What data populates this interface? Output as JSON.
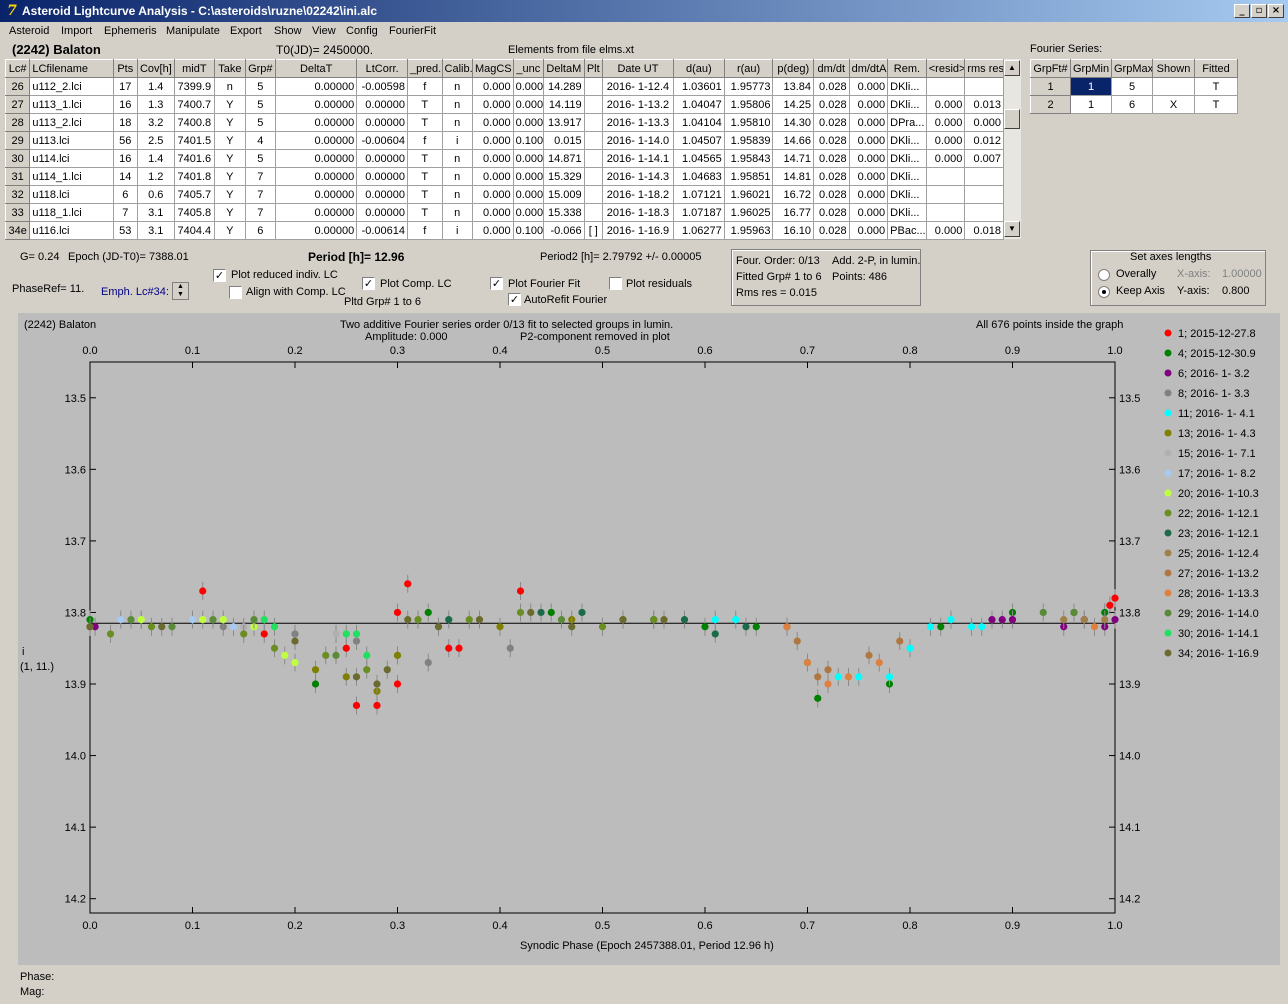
{
  "window": {
    "title": "Asteroid Lightcurve Analysis - C:\\asteroids\\ruzne\\02242\\ini.alc"
  },
  "menu": [
    "Asteroid",
    "Import",
    "Ephemeris",
    "Manipulate",
    "Export",
    "Show",
    "View",
    "Config",
    "FourierFit"
  ],
  "header": {
    "asteroid": "(2242) Balaton",
    "t0": "T0(JD)= 2450000.",
    "elements": "Elements from file elms.xt"
  },
  "table": {
    "columns": [
      "Lc#",
      "LCfilename",
      "Pts",
      "Cov[h]",
      "midT",
      "Take",
      "Grp#",
      "DeltaT",
      "LtCorr.",
      "_pred.",
      "Calib.",
      "MagCS",
      "_unc",
      "DeltaM",
      "Plt",
      "Date UT",
      "d(au)",
      "r(au)",
      "p(deg)",
      "dm/dt",
      "dm/dtA",
      "Rem.",
      "<resid>",
      "rms res"
    ],
    "rows": [
      [
        "26",
        "u112_2.lci",
        "17",
        "1.4",
        "7399.9",
        "n",
        "5",
        "0.00000",
        "-0.00598",
        "f",
        "n",
        "0.000",
        "0.000",
        "14.289",
        "",
        "2016- 1-12.4",
        "1.03601",
        "1.95773",
        "13.84",
        "0.028",
        "0.000",
        "DKli...",
        "",
        ""
      ],
      [
        "27",
        "u113_1.lci",
        "16",
        "1.3",
        "7400.7",
        "Y",
        "5",
        "0.00000",
        "0.00000",
        "T",
        "n",
        "0.000",
        "0.000",
        "14.119",
        "",
        "2016- 1-13.2",
        "1.04047",
        "1.95806",
        "14.25",
        "0.028",
        "0.000",
        "DKli...",
        "0.000",
        "0.013"
      ],
      [
        "28",
        "u113_2.lci",
        "18",
        "3.2",
        "7400.8",
        "Y",
        "5",
        "0.00000",
        "0.00000",
        "T",
        "n",
        "0.000",
        "0.000",
        "13.917",
        "",
        "2016- 1-13.3",
        "1.04104",
        "1.95810",
        "14.30",
        "0.028",
        "0.000",
        "DPra...",
        "0.000",
        "0.000"
      ],
      [
        "29",
        "u113.lci",
        "56",
        "2.5",
        "7401.5",
        "Y",
        "4",
        "0.00000",
        "-0.00604",
        "f",
        "i",
        "0.000",
        "0.100",
        "0.015",
        "",
        "2016- 1-14.0",
        "1.04507",
        "1.95839",
        "14.66",
        "0.028",
        "0.000",
        "DKli...",
        "0.000",
        "0.012"
      ],
      [
        "30",
        "u114.lci",
        "16",
        "1.4",
        "7401.6",
        "Y",
        "5",
        "0.00000",
        "0.00000",
        "T",
        "n",
        "0.000",
        "0.000",
        "14.871",
        "",
        "2016- 1-14.1",
        "1.04565",
        "1.95843",
        "14.71",
        "0.028",
        "0.000",
        "DKli...",
        "0.000",
        "0.007"
      ],
      [
        "31",
        "u114_1.lci",
        "14",
        "1.2",
        "7401.8",
        "Y",
        "7",
        "0.00000",
        "0.00000",
        "T",
        "n",
        "0.000",
        "0.000",
        "15.329",
        "",
        "2016- 1-14.3",
        "1.04683",
        "1.95851",
        "14.81",
        "0.028",
        "0.000",
        "DKli...",
        "",
        ""
      ],
      [
        "32",
        "u118.lci",
        "6",
        "0.6",
        "7405.7",
        "Y",
        "7",
        "0.00000",
        "0.00000",
        "T",
        "n",
        "0.000",
        "0.000",
        "15.009",
        "",
        "2016- 1-18.2",
        "1.07121",
        "1.96021",
        "16.72",
        "0.028",
        "0.000",
        "DKli...",
        "",
        ""
      ],
      [
        "33",
        "u118_1.lci",
        "7",
        "3.1",
        "7405.8",
        "Y",
        "7",
        "0.00000",
        "0.00000",
        "T",
        "n",
        "0.000",
        "0.000",
        "15.338",
        "",
        "2016- 1-18.3",
        "1.07187",
        "1.96025",
        "16.77",
        "0.028",
        "0.000",
        "DKli...",
        "",
        ""
      ],
      [
        "34e",
        "u116.lci",
        "53",
        "3.1",
        "7404.4",
        "Y",
        "6",
        "0.00000",
        "-0.00614",
        "f",
        "i",
        "0.000",
        "0.100",
        "-0.066",
        "[ ]",
        "2016- 1-16.9",
        "1.06277",
        "1.95963",
        "16.10",
        "0.028",
        "0.000",
        "PBac...",
        "0.000",
        "0.018"
      ]
    ]
  },
  "fourier_series": {
    "title": "Fourier Series:",
    "columns": [
      "GrpFt#",
      "GrpMin",
      "GrpMax",
      "Shown",
      "Fitted"
    ],
    "rows": [
      [
        "1",
        "1",
        "5",
        "",
        "T"
      ],
      [
        "2",
        "1",
        "6",
        "X",
        "T"
      ]
    ]
  },
  "controls": {
    "g": "G= 0.24",
    "epoch": "Epoch (JD-T0)= 7388.01",
    "period": "Period [h]= 12.96",
    "period2": "Period2 [h]= 2.79792 +/- 0.00005",
    "phaseref": "PhaseRef= 11.",
    "emph": "Emph. Lc#34:",
    "plot_reduced": "Plot reduced indiv. LC",
    "align": "Align with Comp. LC",
    "plot_comp": "Plot Comp. LC",
    "pltd_grp": "Pltd Grp#  1   to   6",
    "plot_fourier": "Plot Fourier Fit",
    "autorefit": "AutoRefit Fourier",
    "plot_residuals": "Plot residuals"
  },
  "info": {
    "four_order": "Four. Order:  0/13",
    "add": "Add. 2-P, in lumin.",
    "fitted": "Fitted Grp# 1 to 6",
    "points": "Points: 486",
    "rms": "Rms res     = 0.015"
  },
  "axes_box": {
    "title": "Set axes lengths",
    "overally": "Overally",
    "keep": "Keep Axis",
    "xaxis_label": "X-axis:",
    "xaxis_value": "1.00000",
    "yaxis_label": "Y-axis:",
    "yaxis_value": "0.800"
  },
  "plot": {
    "name": "(2242) Balaton",
    "subtitle1": "Two additive Fourier series order 0/13 fit to selected groups in lumin.",
    "subtitle2a": "Amplitude: 0.000",
    "subtitle2b": "P2-component removed in plot",
    "points_note": "All 676 points inside the graph",
    "ylabel": "i",
    "ylabel2": "(1, 11.)",
    "xlabel": "Synodic Phase (Epoch 2457388.01, Period 12.96 h)"
  },
  "chart_data": {
    "type": "scatter",
    "xlim": [
      0.0,
      1.0
    ],
    "ylim": [
      14.22,
      13.45
    ],
    "x_ticks": [
      "0.0",
      "0.1",
      "0.2",
      "0.3",
      "0.4",
      "0.5",
      "0.6",
      "0.7",
      "0.8",
      "0.9",
      "1.0"
    ],
    "y_ticks": [
      "13.5",
      "13.6",
      "13.7",
      "13.8",
      "13.9",
      "14.0",
      "14.1",
      "14.2"
    ],
    "fit_line_y": 13.815,
    "legend": [
      {
        "label": "1; 2015-12-27.8",
        "color": "#ff0000"
      },
      {
        "label": "4; 2015-12-30.9",
        "color": "#008000"
      },
      {
        "label": "6; 2016- 1- 3.2",
        "color": "#800080"
      },
      {
        "label": "8; 2016- 1- 3.3",
        "color": "#808080"
      },
      {
        "label": "11; 2016- 1- 4.1",
        "color": "#00ffff"
      },
      {
        "label": "13; 2016- 1- 4.3",
        "color": "#808000"
      },
      {
        "label": "15; 2016- 1- 7.1",
        "color": "#b0b0b0"
      },
      {
        "label": "17; 2016- 1- 8.2",
        "color": "#a6caf0"
      },
      {
        "label": "20; 2016- 1-10.3",
        "color": "#c0ff40"
      },
      {
        "label": "22; 2016- 1-12.1",
        "color": "#6b8e23"
      },
      {
        "label": "23; 2016- 1-12.1",
        "color": "#1b6b4a"
      },
      {
        "label": "25; 2016- 1-12.4",
        "color": "#a0804a"
      },
      {
        "label": "27; 2016- 1-13.2",
        "color": "#b07840"
      },
      {
        "label": "28; 2016- 1-13.3",
        "color": "#e08040"
      },
      {
        "label": "29; 2016- 1-14.0",
        "color": "#5a8a3a"
      },
      {
        "label": "30; 2016- 1-14.1",
        "color": "#20e060"
      },
      {
        "label": "34; 2016- 1-16.9",
        "color": "#6b6b30"
      }
    ],
    "series": [
      {
        "color": "#ff0000",
        "points": [
          [
            0.0,
            13.82
          ],
          [
            0.11,
            13.77
          ],
          [
            0.17,
            13.83
          ],
          [
            0.25,
            13.85
          ],
          [
            0.3,
            13.8
          ],
          [
            0.31,
            13.76
          ],
          [
            0.35,
            13.85
          ],
          [
            0.36,
            13.85
          ],
          [
            0.42,
            13.77
          ],
          [
            0.26,
            13.93
          ],
          [
            0.28,
            13.93
          ],
          [
            0.3,
            13.9
          ],
          [
            0.995,
            13.79
          ],
          [
            1.0,
            13.78
          ]
        ]
      },
      {
        "color": "#008000",
        "points": [
          [
            0.0,
            13.81
          ],
          [
            0.22,
            13.9
          ],
          [
            0.33,
            13.8
          ],
          [
            0.45,
            13.8
          ],
          [
            0.55,
            13.81
          ],
          [
            0.6,
            13.82
          ],
          [
            0.65,
            13.82
          ],
          [
            0.68,
            13.82
          ],
          [
            0.7,
            13.87
          ],
          [
            0.71,
            13.92
          ],
          [
            0.78,
            13.9
          ],
          [
            0.83,
            13.82
          ],
          [
            0.9,
            13.8
          ],
          [
            0.96,
            13.8
          ],
          [
            0.99,
            13.8
          ]
        ]
      },
      {
        "color": "#800080",
        "points": [
          [
            0.005,
            13.82
          ],
          [
            0.88,
            13.81
          ],
          [
            0.89,
            13.81
          ],
          [
            0.9,
            13.81
          ],
          [
            0.95,
            13.82
          ],
          [
            0.97,
            13.81
          ],
          [
            0.99,
            13.82
          ],
          [
            1.0,
            13.81
          ]
        ]
      },
      {
        "color": "#808080",
        "points": [
          [
            0.13,
            13.82
          ],
          [
            0.2,
            13.83
          ],
          [
            0.26,
            13.84
          ],
          [
            0.3,
            13.86
          ],
          [
            0.33,
            13.87
          ],
          [
            0.41,
            13.85
          ]
        ]
      },
      {
        "color": "#00ffff",
        "points": [
          [
            0.61,
            13.81
          ],
          [
            0.63,
            13.81
          ],
          [
            0.73,
            13.89
          ],
          [
            0.75,
            13.89
          ],
          [
            0.78,
            13.89
          ],
          [
            0.8,
            13.85
          ],
          [
            0.82,
            13.82
          ],
          [
            0.84,
            13.81
          ],
          [
            0.86,
            13.82
          ],
          [
            0.87,
            13.82
          ]
        ]
      },
      {
        "color": "#808000",
        "points": [
          [
            0.22,
            13.88
          ],
          [
            0.25,
            13.89
          ],
          [
            0.28,
            13.91
          ],
          [
            0.3,
            13.86
          ],
          [
            0.4,
            13.82
          ],
          [
            0.47,
            13.81
          ]
        ]
      },
      {
        "color": "#b0b0b0",
        "points": [
          [
            0.05,
            13.81
          ],
          [
            0.15,
            13.82
          ],
          [
            0.24,
            13.83
          ],
          [
            0.32,
            13.81
          ]
        ]
      },
      {
        "color": "#a6caf0",
        "points": [
          [
            0.03,
            13.81
          ],
          [
            0.1,
            13.81
          ],
          [
            0.14,
            13.82
          ]
        ]
      },
      {
        "color": "#c0ff40",
        "points": [
          [
            0.05,
            13.81
          ],
          [
            0.11,
            13.81
          ],
          [
            0.13,
            13.81
          ],
          [
            0.16,
            13.82
          ],
          [
            0.19,
            13.86
          ],
          [
            0.2,
            13.87
          ]
        ]
      },
      {
        "color": "#6b8e23",
        "points": [
          [
            0.02,
            13.83
          ],
          [
            0.06,
            13.82
          ],
          [
            0.15,
            13.83
          ],
          [
            0.18,
            13.85
          ],
          [
            0.23,
            13.86
          ],
          [
            0.27,
            13.88
          ],
          [
            0.32,
            13.81
          ],
          [
            0.37,
            13.81
          ],
          [
            0.42,
            13.8
          ],
          [
            0.5,
            13.82
          ],
          [
            0.55,
            13.81
          ]
        ]
      },
      {
        "color": "#1b6b4a",
        "points": [
          [
            0.35,
            13.81
          ],
          [
            0.44,
            13.8
          ],
          [
            0.48,
            13.8
          ],
          [
            0.58,
            13.81
          ],
          [
            0.61,
            13.83
          ],
          [
            0.64,
            13.82
          ]
        ]
      },
      {
        "color": "#a0804a",
        "points": [
          [
            0.95,
            13.81
          ],
          [
            0.97,
            13.81
          ],
          [
            0.99,
            13.81
          ]
        ]
      },
      {
        "color": "#b07840",
        "points": [
          [
            0.69,
            13.84
          ],
          [
            0.71,
            13.89
          ],
          [
            0.72,
            13.88
          ],
          [
            0.76,
            13.86
          ],
          [
            0.79,
            13.84
          ]
        ]
      },
      {
        "color": "#e08040",
        "points": [
          [
            0.68,
            13.82
          ],
          [
            0.7,
            13.87
          ],
          [
            0.72,
            13.9
          ],
          [
            0.74,
            13.89
          ],
          [
            0.77,
            13.87
          ],
          [
            0.98,
            13.82
          ]
        ]
      },
      {
        "color": "#5a8a3a",
        "points": [
          [
            0.0,
            13.82
          ],
          [
            0.04,
            13.81
          ],
          [
            0.08,
            13.82
          ],
          [
            0.12,
            13.81
          ],
          [
            0.16,
            13.81
          ],
          [
            0.24,
            13.86
          ],
          [
            0.34,
            13.82
          ],
          [
            0.46,
            13.81
          ],
          [
            0.52,
            13.81
          ],
          [
            0.93,
            13.8
          ],
          [
            0.96,
            13.8
          ]
        ]
      },
      {
        "color": "#20e060",
        "points": [
          [
            0.17,
            13.81
          ],
          [
            0.18,
            13.82
          ],
          [
            0.25,
            13.83
          ],
          [
            0.26,
            13.83
          ],
          [
            0.27,
            13.86
          ]
        ]
      },
      {
        "color": "#6b6b30",
        "points": [
          [
            0.0,
            13.82
          ],
          [
            0.07,
            13.82
          ],
          [
            0.2,
            13.84
          ],
          [
            0.26,
            13.89
          ],
          [
            0.28,
            13.9
          ],
          [
            0.29,
            13.88
          ],
          [
            0.31,
            13.81
          ],
          [
            0.34,
            13.82
          ],
          [
            0.38,
            13.81
          ],
          [
            0.43,
            13.8
          ],
          [
            0.47,
            13.82
          ],
          [
            0.52,
            13.81
          ],
          [
            0.56,
            13.81
          ]
        ]
      }
    ]
  }
}
